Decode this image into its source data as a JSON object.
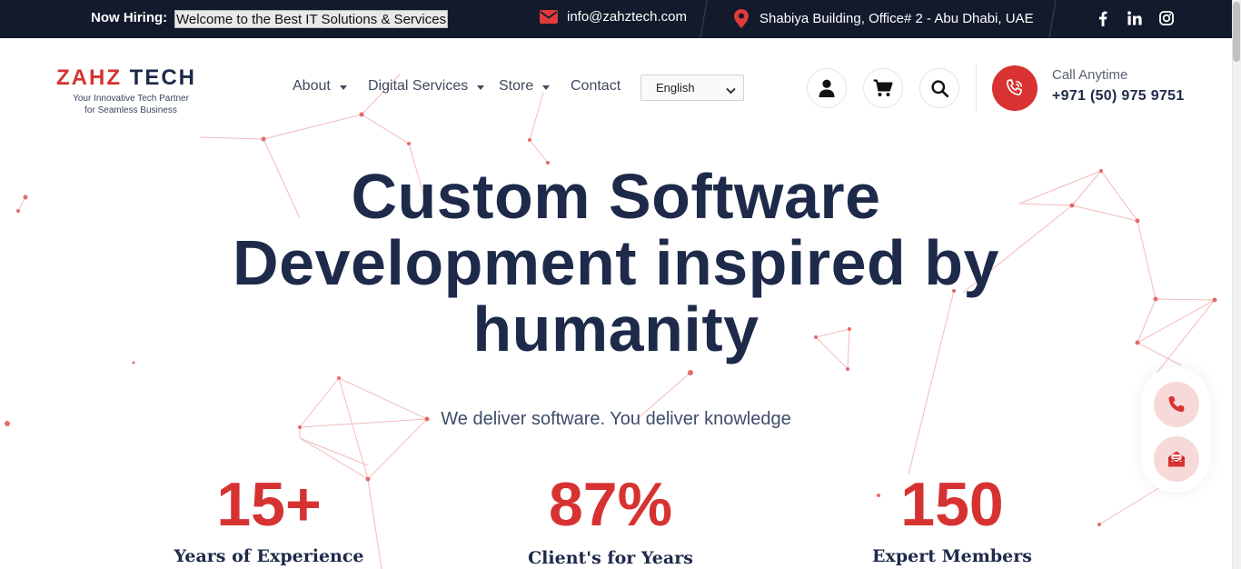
{
  "topbar": {
    "hiring_label": "Now Hiring:",
    "marquee_text": "Welcome to the Best IT Solutions & Services",
    "email": "info@zahztech.com",
    "address": "Shabiya Building, Office# 2 - Abu Dhabi, UAE",
    "icons": [
      "envelope-icon",
      "map-pin-icon",
      "facebook-icon",
      "linkedin-icon",
      "instagram-icon"
    ]
  },
  "logo": {
    "brand_red": "ZAHZ",
    "brand_navy": "TECH",
    "tagline_1": "Your Innovative Tech Partner",
    "tagline_2": "for Seamless Business"
  },
  "nav": {
    "items": [
      {
        "label": "About"
      },
      {
        "label": "Digital Services"
      },
      {
        "label": "Store"
      },
      {
        "label": "Contact"
      }
    ],
    "language": "English"
  },
  "header": {
    "icons": [
      "user-icon",
      "cart-icon",
      "search-icon",
      "phone-icon"
    ],
    "call_label": "Call Anytime",
    "call_number": "+971 (50) 975 9751"
  },
  "hero": {
    "title_line1": "Custom Software",
    "title_line2": "Development inspired by",
    "title_line3": "humanity",
    "subtitle": "We deliver software. You deliver knowledge"
  },
  "stats": [
    {
      "value": "15+",
      "label": "Years of Experience"
    },
    {
      "value": "87%",
      "label": "Client's for Years"
    },
    {
      "value": "150",
      "label": "Expert Members"
    }
  ],
  "colors": {
    "topbar_bg": "#121a2c",
    "accent_red": "#d73232",
    "navy": "#1e2a4a"
  }
}
